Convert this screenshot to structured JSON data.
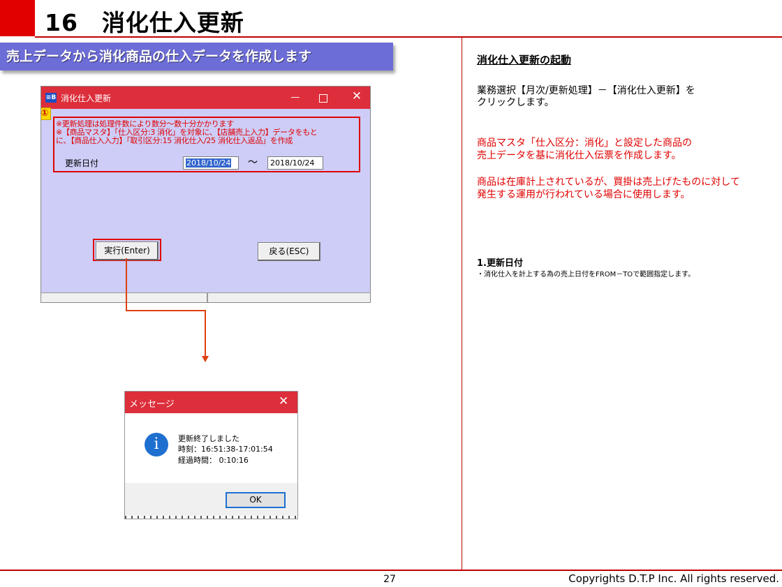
{
  "page": {
    "title": "16　消化仕入更新",
    "section_banner": "売上データから消化商品の仕入データを作成します",
    "page_number": "27",
    "copyright": "Copyrights  D.T.P Inc. All rights reserved."
  },
  "app_window": {
    "logo": "≡B",
    "title": "消化仕入更新",
    "marker": "①",
    "notes": [
      "※更新処理は処理件数により数分～数十分かかります",
      "※【商品マスタ】「仕入区分:3 消化」を対象に、【店舗売上入力】データをもと",
      "に、【商品仕入入力】「取引区分:15 消化仕入/25 消化仕入返品」を作成"
    ],
    "update_date_label": "更新日付",
    "date_from": "2018/10/24",
    "date_separator": "～",
    "date_to": "2018/10/24",
    "execute_button": "実行(Enter)",
    "back_button": "戻る(ESC)"
  },
  "message_dialog": {
    "title": "メッセージ",
    "lines": [
      "更新終了しました",
      "時刻：16:51:38-17:01:54",
      "経過時間： 0:10:16"
    ],
    "ok_button": "OK"
  },
  "right_panel": {
    "heading": "消化仕入更新の起動",
    "instruction": [
      "業務選択【月次/更新処理】－【消化仕入更新】を",
      "クリックします。"
    ],
    "description_1": [
      "商品マスタ「仕入区分：消化」と設定した商品の",
      "売上データを基に消化仕入伝票を作成します。"
    ],
    "description_2": [
      "商品は在庫計上されているが、買掛は売上げたものに対して",
      "発生する運用が行われている場合に使用します。"
    ],
    "item_heading": "1.更新日付",
    "item_description": "・消化仕入を計上する為の売上日付をFROM－TOで範囲指定します。"
  },
  "colors": {
    "accent_red": "#e00000",
    "titlebar_red": "#dc2f3b",
    "banner_purple": "#6d6dd8",
    "window_lavender": "#cdcdf7",
    "info_blue": "#1e6fd0"
  }
}
